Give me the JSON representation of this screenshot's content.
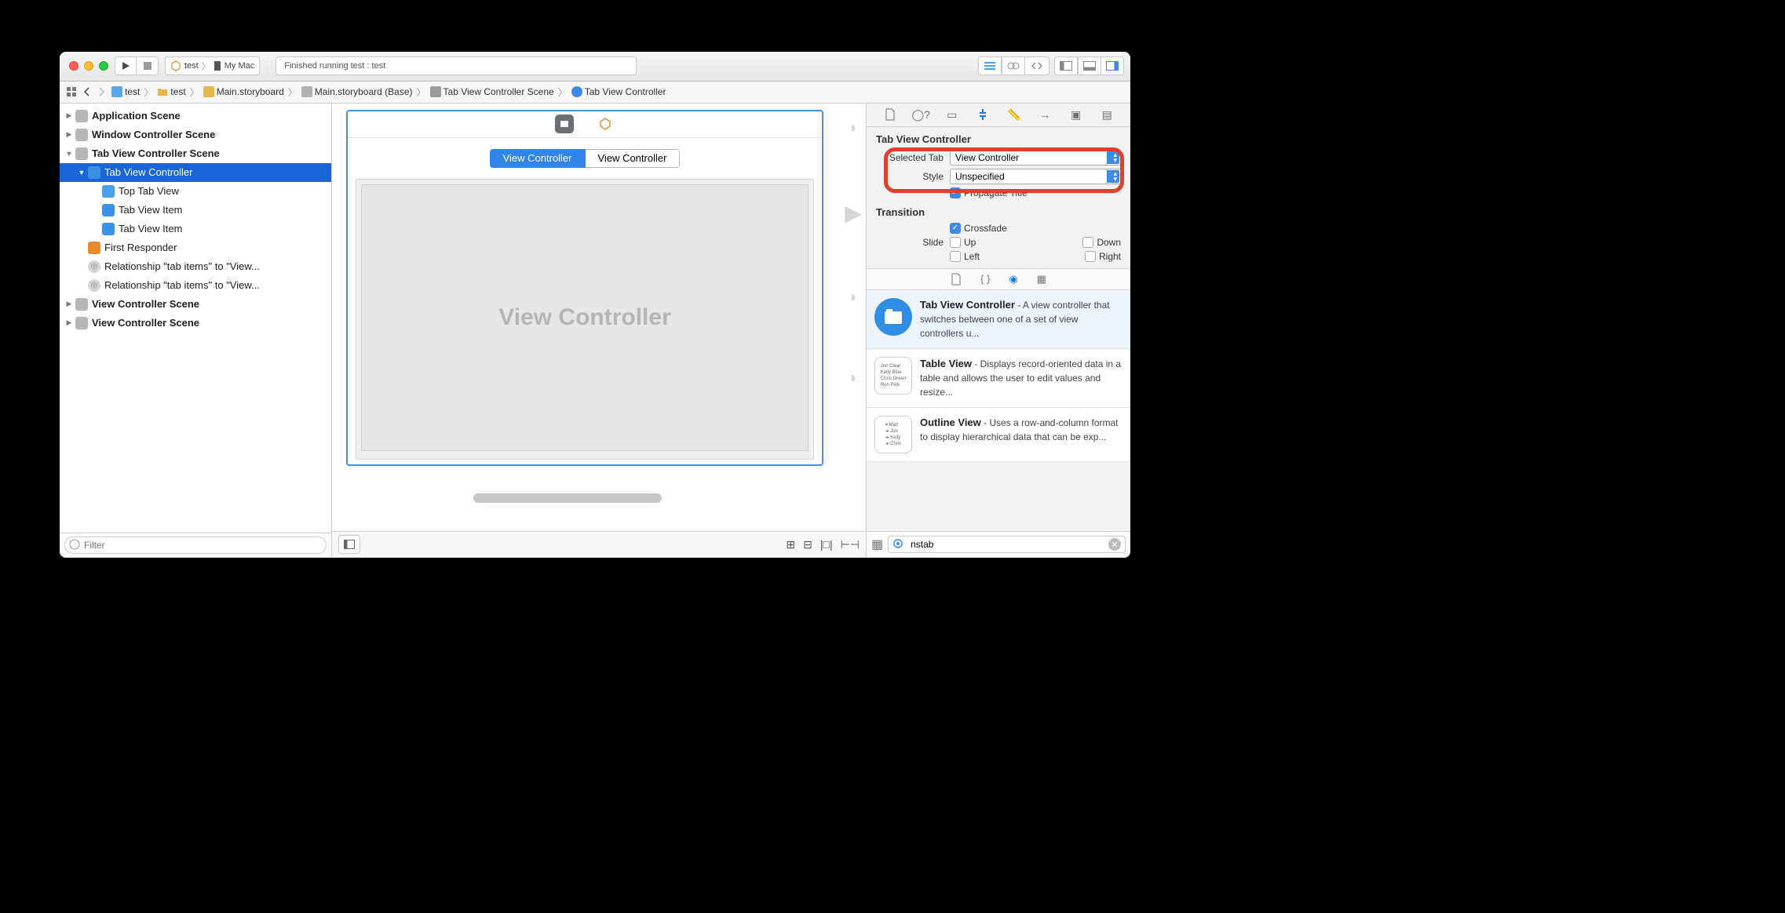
{
  "toolbar": {
    "scheme": "test",
    "device": "My Mac",
    "status": "Finished running test : test"
  },
  "breadcrumbs": [
    "test",
    "test",
    "Main.storyboard",
    "Main.storyboard (Base)",
    "Tab View Controller Scene",
    "Tab View Controller"
  ],
  "outline": {
    "appScene": "Application Scene",
    "winScene": "Window Controller Scene",
    "tabScene": "Tab View Controller Scene",
    "tabVC": "Tab View Controller",
    "topTab": "Top Tab View",
    "tvi1": "Tab View Item",
    "tvi2": "Tab View Item",
    "firstResp": "First Responder",
    "rel1": "Relationship \"tab items\" to \"View...",
    "rel2": "Relationship \"tab items\" to \"View...",
    "vcScene1": "View Controller Scene",
    "vcScene2": "View Controller Scene"
  },
  "filter_placeholder": "Filter",
  "canvas": {
    "tab1": "View Controller",
    "tab2": "View Controller",
    "placeholder": "View Controller"
  },
  "inspector": {
    "section": "Tab View Controller",
    "selTab_label": "Selected Tab",
    "selTab_value": "View Controller",
    "style_label": "Style",
    "style_value": "Unspecified",
    "propagate": "Propagate Title",
    "transition": "Transition",
    "crossfade": "Crossfade",
    "slide": "Slide",
    "up": "Up",
    "down": "Down",
    "left": "Left",
    "right": "Right"
  },
  "library": {
    "item1_title": "Tab View Controller",
    "item1_desc": " - A view controller that switches between one of a set of view controllers u...",
    "item2_title": "Table View",
    "item2_desc": " - Displays record-oriented data in a table and allows the user to edit values and resize...",
    "item3_title": "Outline View",
    "item3_desc": " - Uses a row-and-column format to display hierarchical data that can be exp...",
    "filter_value": "nstab"
  }
}
